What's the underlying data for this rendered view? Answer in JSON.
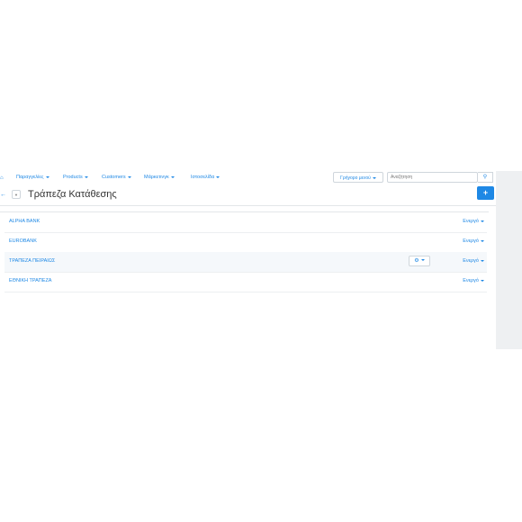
{
  "nav": {
    "items": [
      {
        "label": "Παραγγελίες"
      },
      {
        "label": "Products"
      },
      {
        "label": "Customers"
      },
      {
        "label": "Μάρκετινγκ"
      },
      {
        "label": "Ιστοσελίδα"
      }
    ],
    "quick_menu_label": "Γρήγορο μενού",
    "search_placeholder": "Αναζήτηση"
  },
  "page": {
    "title": "Τράπεζα Κατάθεσης"
  },
  "rows": [
    {
      "name": "ALPHA BANK",
      "status": "Ενεργό"
    },
    {
      "name": "EUROBANK",
      "status": "Ενεργό"
    },
    {
      "name": "ΤΡΑΠΕΖΑ ΠΕΙΡΑΙΩΣ",
      "status": "Ενεργό"
    },
    {
      "name": "ΕΘΝΙΚΗ ΤΡΑΠΕΖΑ",
      "status": "Ενεργό"
    }
  ],
  "colors": {
    "accent": "#1e88e5",
    "text": "#333333",
    "border": "#cfd6dc"
  },
  "icons": {
    "home": "home-icon",
    "search": "search-icon",
    "back": "arrow-left-icon",
    "add": "plus-icon",
    "gear": "gear-icon"
  }
}
